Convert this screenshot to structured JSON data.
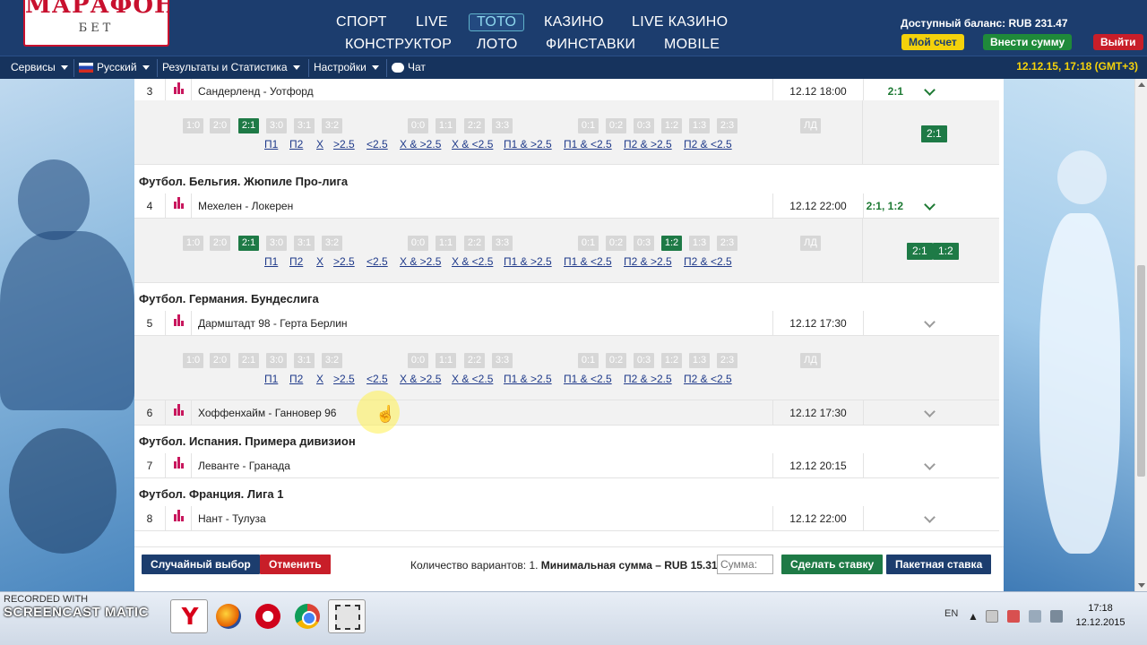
{
  "header": {
    "logo_top": "МАРАФОН",
    "logo_bottom": "БЕТ",
    "nav": [
      "СПОРТ",
      "LIVE",
      "ТОТО",
      "КАЗИНО",
      "LIVE КАЗИНО",
      "КОНСТРУКТОР",
      "ЛОТО",
      "ФИНСТАВКИ",
      "MOBILE"
    ],
    "active_nav": "ТОТО",
    "balance": "Доступный баланс: RUB 231.47",
    "btn_account": "Мой счет",
    "btn_deposit": "Внести сумму",
    "btn_logout": "Выйти"
  },
  "subnav": {
    "services": "Сервисы",
    "language": "Русский",
    "results": "Результаты и Статистика",
    "settings": "Настройки",
    "chat": "Чат",
    "datetime": "12.12.15, 17:18 (GMT+3)"
  },
  "score_options": [
    "1:0",
    "2:0",
    "2:1",
    "3:0",
    "3:1",
    "3:2",
    "0:0",
    "1:1",
    "2:2",
    "3:3",
    "0:1",
    "0:2",
    "0:3",
    "1:2",
    "1:3",
    "2:3"
  ],
  "other_option": "ЛД",
  "outcome_links": [
    "П1",
    "П2",
    "Х",
    ">2.5",
    "<2.5",
    "Х & >2.5",
    "Х & <2.5",
    "П1 & >2.5",
    "П1 & <2.5",
    "П2 & >2.5",
    "П2 & <2.5"
  ],
  "leagues": {
    "belgium": "Футбол. Бельгия. Жюпиле Про-лига",
    "germany": "Футбол. Германия. Бундеслига",
    "spain": "Футбол. Испания. Примера дивизион",
    "france": "Футбол. Франция. Лига 1"
  },
  "events": [
    {
      "num": "3",
      "teams": "Сандерленд - Уотфорд",
      "score": "2:1",
      "time": "12.12 18:00",
      "picked": [
        "2:1"
      ]
    },
    {
      "num": "4",
      "teams": "Мехелен - Локерен",
      "score": "2:1, 1:2",
      "time": "12.12 22:00",
      "picked": [
        "2:1",
        "1:2"
      ]
    },
    {
      "num": "5",
      "teams": "Дармштадт 98 - Герта Берлин",
      "score": "",
      "time": "12.12 17:30"
    },
    {
      "num": "6",
      "teams": "Хоффенхайм - Ганновер 96",
      "score": "",
      "time": "12.12 17:30"
    },
    {
      "num": "7",
      "teams": "Леванте - Гранада",
      "score": "",
      "time": "12.12 20:15"
    },
    {
      "num": "8",
      "teams": "Нант - Тулуза",
      "score": "",
      "time": "12.12 22:00"
    }
  ],
  "bottom": {
    "random": "Случайный выбор",
    "cancel": "Отменить",
    "variants_prefix": "Количество вариантов: 1.",
    "variants_min": "Минимальная сумма – RUB 15.31",
    "sum_placeholder": "Сумма:",
    "make_bet": "Сделать ставку",
    "package_bet": "Пакетная ставка"
  },
  "taskbar": {
    "recorded": "RECORDED WITH",
    "screencast": "SCREENCAST",
    "matic": "MATIC",
    "yandex": "Y",
    "lang": "EN",
    "time": "17:18",
    "date": "12.12.2015"
  }
}
